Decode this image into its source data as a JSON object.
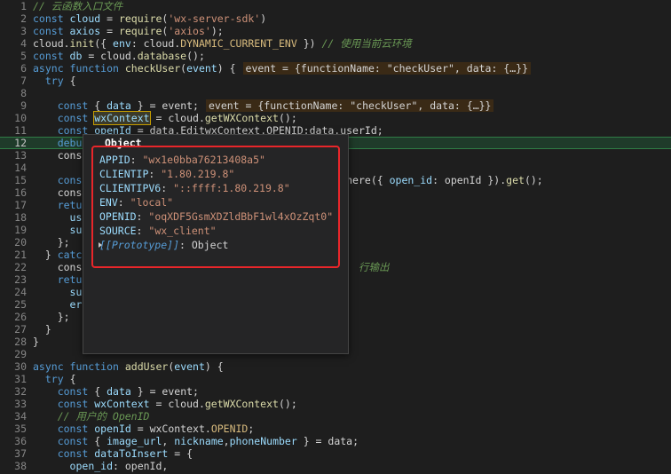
{
  "lines": [
    {
      "num": "1",
      "t": [
        [
          "cm",
          "// 云函数入口文件"
        ]
      ]
    },
    {
      "num": "2",
      "t": [
        [
          "kw",
          "const "
        ],
        [
          "var",
          "cloud"
        ],
        [
          "pl",
          " = "
        ],
        [
          "fn",
          "require"
        ],
        [
          "pl",
          "("
        ],
        [
          "str",
          "'wx-server-sdk'"
        ],
        [
          "pl",
          ")"
        ]
      ]
    },
    {
      "num": "3",
      "t": [
        [
          "kw",
          "const "
        ],
        [
          "var",
          "axios"
        ],
        [
          "pl",
          " = "
        ],
        [
          "fn",
          "require"
        ],
        [
          "pl",
          "("
        ],
        [
          "str",
          "'axios'"
        ],
        [
          "pl",
          ");"
        ]
      ]
    },
    {
      "num": "4",
      "t": [
        [
          "pl",
          "cloud."
        ],
        [
          "fn",
          "init"
        ],
        [
          "pl",
          "({ "
        ],
        [
          "var",
          "env"
        ],
        [
          "pl",
          ": cloud."
        ],
        [
          "const",
          "DYNAMIC_CURRENT_ENV"
        ],
        [
          "pl",
          " }) "
        ],
        [
          "cm",
          "// 使用当前云环境"
        ]
      ]
    },
    {
      "num": "5",
      "t": [
        [
          "kw",
          "const "
        ],
        [
          "var",
          "db"
        ],
        [
          "pl",
          " = cloud."
        ],
        [
          "fn",
          "database"
        ],
        [
          "pl",
          "();"
        ]
      ]
    },
    {
      "num": "6",
      "t": [
        [
          "kw",
          "async function "
        ],
        [
          "fn",
          "checkUser"
        ],
        [
          "pl",
          "("
        ],
        [
          "var",
          "event"
        ],
        [
          "pl",
          ") {"
        ]
      ],
      "inline": "event = {functionName: \"checkUser\", data: {…}}"
    },
    {
      "num": "7",
      "t": [
        [
          "pl",
          "  "
        ],
        [
          "kw",
          "try"
        ],
        [
          "pl",
          " {"
        ]
      ]
    },
    {
      "num": "8",
      "t": []
    },
    {
      "num": "9",
      "t": [
        [
          "pl",
          "    "
        ],
        [
          "kw",
          "const "
        ],
        [
          "pl",
          "{ "
        ],
        [
          "var",
          "data"
        ],
        [
          "pl",
          " } = event;"
        ]
      ],
      "inline": "event = {functionName: \"checkUser\", data: {…}}"
    },
    {
      "num": "10",
      "t": [
        [
          "pl",
          "    "
        ],
        [
          "kw",
          "const "
        ],
        [
          "var",
          "wxContext"
        ],
        [
          "pl",
          " = cloud."
        ],
        [
          "fn",
          "getWXContext"
        ],
        [
          "pl",
          "();"
        ]
      ]
    },
    {
      "num": "11",
      "t": [
        [
          "pl",
          "    "
        ],
        [
          "kw",
          "const "
        ],
        [
          "var",
          "openId"
        ],
        [
          "pl",
          " = "
        ],
        [
          "pl",
          "data.EditwxContext.OPENID:data.userId;"
        ]
      ]
    },
    {
      "num": "12",
      "t": [
        [
          "pl",
          "    "
        ],
        [
          "kw",
          "debugger"
        ],
        [
          "pl",
          ";"
        ]
      ],
      "cur": true
    },
    {
      "num": "13",
      "t": [
        [
          "pl",
          "    console.log"
        ]
      ]
    },
    {
      "num": "14",
      "t": []
    },
    {
      "num": "15",
      "t": [
        [
          "pl",
          "    "
        ],
        [
          "kw",
          "const"
        ],
        [
          "pl",
          "                                        "
        ],
        [
          "pl",
          ".where({ "
        ],
        [
          "var",
          "open_id"
        ],
        [
          "pl",
          ": openId })."
        ],
        [
          "fn",
          "get"
        ],
        [
          "pl",
          "();"
        ]
      ]
    },
    {
      "num": "16",
      "t": [
        [
          "pl",
          "    console"
        ]
      ]
    },
    {
      "num": "17",
      "t": [
        [
          "pl",
          "    "
        ],
        [
          "kw",
          "return"
        ]
      ]
    },
    {
      "num": "18",
      "t": [
        [
          "pl",
          "      "
        ],
        [
          "var",
          "use"
        ]
      ]
    },
    {
      "num": "19",
      "t": [
        [
          "pl",
          "      "
        ],
        [
          "var",
          "suc"
        ]
      ]
    },
    {
      "num": "20",
      "t": [
        [
          "pl",
          "    };"
        ]
      ]
    },
    {
      "num": "21",
      "t": [
        [
          "pl",
          "  } "
        ],
        [
          "kw",
          "catch"
        ]
      ]
    },
    {
      "num": "22",
      "t": [
        [
          "pl",
          "    console"
        ],
        [
          "pl",
          "                                        "
        ],
        [
          "cm",
          "  行输出"
        ]
      ]
    },
    {
      "num": "23",
      "t": [
        [
          "pl",
          "    "
        ],
        [
          "kw",
          "return"
        ]
      ]
    },
    {
      "num": "24",
      "t": [
        [
          "pl",
          "      "
        ],
        [
          "var",
          "suc"
        ]
      ]
    },
    {
      "num": "25",
      "t": [
        [
          "pl",
          "      "
        ],
        [
          "var",
          "err"
        ]
      ]
    },
    {
      "num": "26",
      "t": [
        [
          "pl",
          "    };"
        ]
      ]
    },
    {
      "num": "27",
      "t": [
        [
          "pl",
          "  }"
        ]
      ]
    },
    {
      "num": "28",
      "t": [
        [
          "pl",
          "}"
        ]
      ]
    },
    {
      "num": "29",
      "t": []
    },
    {
      "num": "30",
      "t": [
        [
          "kw",
          "async function "
        ],
        [
          "fn",
          "addUser"
        ],
        [
          "pl",
          "("
        ],
        [
          "var",
          "event"
        ],
        [
          "pl",
          ") {"
        ]
      ]
    },
    {
      "num": "31",
      "t": [
        [
          "pl",
          "  "
        ],
        [
          "kw",
          "try"
        ],
        [
          "pl",
          " {"
        ]
      ]
    },
    {
      "num": "32",
      "t": [
        [
          "pl",
          "    "
        ],
        [
          "kw",
          "const "
        ],
        [
          "pl",
          "{ "
        ],
        [
          "var",
          "data"
        ],
        [
          "pl",
          " } = event;"
        ]
      ]
    },
    {
      "num": "33",
      "t": [
        [
          "pl",
          "    "
        ],
        [
          "kw",
          "const "
        ],
        [
          "var",
          "wxContext"
        ],
        [
          "pl",
          " = cloud."
        ],
        [
          "fn",
          "getWXContext"
        ],
        [
          "pl",
          "();"
        ]
      ]
    },
    {
      "num": "34",
      "t": [
        [
          "pl",
          "    "
        ],
        [
          "cm",
          "// 用户的 OpenID"
        ]
      ]
    },
    {
      "num": "35",
      "t": [
        [
          "pl",
          "    "
        ],
        [
          "kw",
          "const "
        ],
        [
          "var",
          "openId"
        ],
        [
          "pl",
          " = wxContext."
        ],
        [
          "const",
          "OPENID"
        ],
        [
          "pl",
          ";"
        ]
      ]
    },
    {
      "num": "36",
      "t": [
        [
          "pl",
          "    "
        ],
        [
          "kw",
          "const "
        ],
        [
          "pl",
          "{ "
        ],
        [
          "var",
          "image_url"
        ],
        [
          "pl",
          ", "
        ],
        [
          "var",
          "nickname"
        ],
        [
          "pl",
          ","
        ],
        [
          "var",
          "phoneNumber"
        ],
        [
          "pl",
          " } = data;"
        ]
      ]
    },
    {
      "num": "37",
      "t": [
        [
          "pl",
          "    "
        ],
        [
          "kw",
          "const "
        ],
        [
          "var",
          "dataToInsert"
        ],
        [
          "pl",
          " = {"
        ]
      ]
    },
    {
      "num": "38",
      "t": [
        [
          "pl",
          "      "
        ],
        [
          "var",
          "open_id"
        ],
        [
          "pl",
          ": openId,"
        ]
      ]
    }
  ],
  "hover": {
    "title": "Object",
    "props": [
      {
        "k": "APPID",
        "v": "\"wx1e0bba76213408a5\""
      },
      {
        "k": "CLIENTIP",
        "v": "\"1.80.219.8\""
      },
      {
        "k": "CLIENTIPV6",
        "v": "\"::ffff:1.80.219.8\""
      },
      {
        "k": "ENV",
        "v": "\"local\""
      },
      {
        "k": "OPENID",
        "v": "\"oqXDF5GsmXDZldBbF1wl4xOzZqt0\""
      },
      {
        "k": "SOURCE",
        "v": "\"wx_client\""
      }
    ],
    "proto_key": "[[Prototype]]",
    "proto_val": "Object"
  }
}
